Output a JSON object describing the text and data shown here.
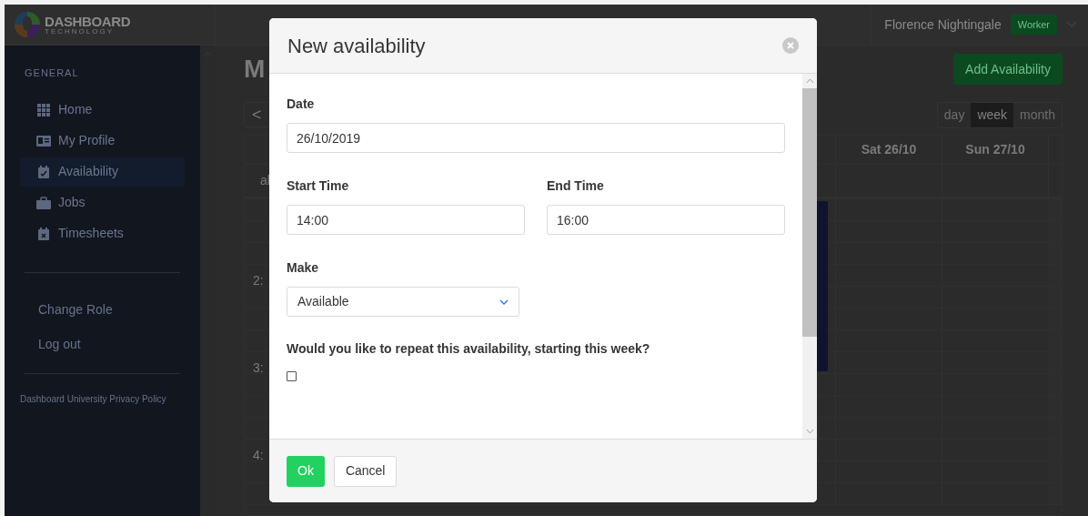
{
  "topbar": {
    "logo_name": "DASHBOARD",
    "logo_tagline": "TECHNOLOGY",
    "user": "Florence Nightingale",
    "role_badge": "Worker"
  },
  "sidebar": {
    "section": "GENERAL",
    "items": [
      {
        "label": "Home",
        "selected": false
      },
      {
        "label": "My Profile",
        "selected": false
      },
      {
        "label": "Availability",
        "selected": true
      },
      {
        "label": "Jobs",
        "selected": false
      },
      {
        "label": "Timesheets",
        "selected": false
      }
    ],
    "links": [
      "Change Role",
      "Log out"
    ],
    "footer": "Dashboard University Privacy Policy"
  },
  "main": {
    "title": "M",
    "add_button": "Add Availability",
    "prev_button": "<",
    "views": [
      {
        "label": "day",
        "selected": false
      },
      {
        "label": "week",
        "selected": true
      },
      {
        "label": "month",
        "selected": false
      }
    ],
    "calendar": {
      "columns": [
        "Sat 26/10",
        "Sun 27/10"
      ],
      "allday_label": "al",
      "time_labels": [
        "2:",
        "3:",
        "4:"
      ]
    }
  },
  "dialog": {
    "title": "New availability",
    "date": {
      "label": "Date",
      "value": "26/10/2019"
    },
    "start_time": {
      "label": "Start Time",
      "value": "14:00"
    },
    "end_time": {
      "label": "End Time",
      "value": "16:00"
    },
    "make": {
      "label": "Make",
      "value": "Available"
    },
    "repeat": {
      "label": "Would you like to repeat this availability, starting this week?",
      "checked": false
    },
    "ok_button": "Ok",
    "cancel_button": "Cancel"
  }
}
